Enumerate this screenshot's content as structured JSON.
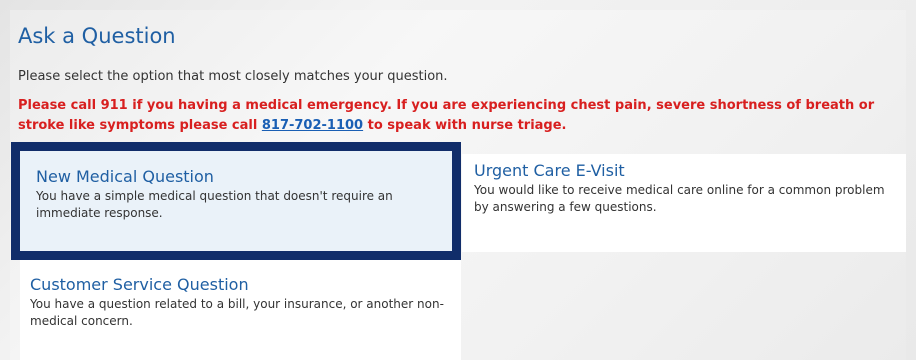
{
  "page": {
    "title": "Ask a Question",
    "intro": "Please select the option that most closely matches your question.",
    "warning_before": "Please call 911 if you having a medical emergency. If you are experiencing chest pain, severe shortness of breath or stroke like symptoms please call ",
    "warning_phone": "817-702-1100",
    "warning_after": " to speak with nurse triage."
  },
  "cards": {
    "medical": {
      "title": "New Medical Question",
      "desc": "You have a simple medical question that doesn't require an immediate response."
    },
    "evisit": {
      "title": "Urgent Care E-Visit",
      "desc": "You would like to receive medical care online for a common problem by answering a few questions."
    },
    "service": {
      "title": "Customer Service Question",
      "desc": "You have a question related to a bill, your insurance, or another non-medical concern."
    }
  },
  "colors": {
    "accent": "#1f5fa3",
    "warning": "#d81f1f",
    "selected_border": "#112d6a",
    "selected_bg": "#eaf2f9"
  }
}
